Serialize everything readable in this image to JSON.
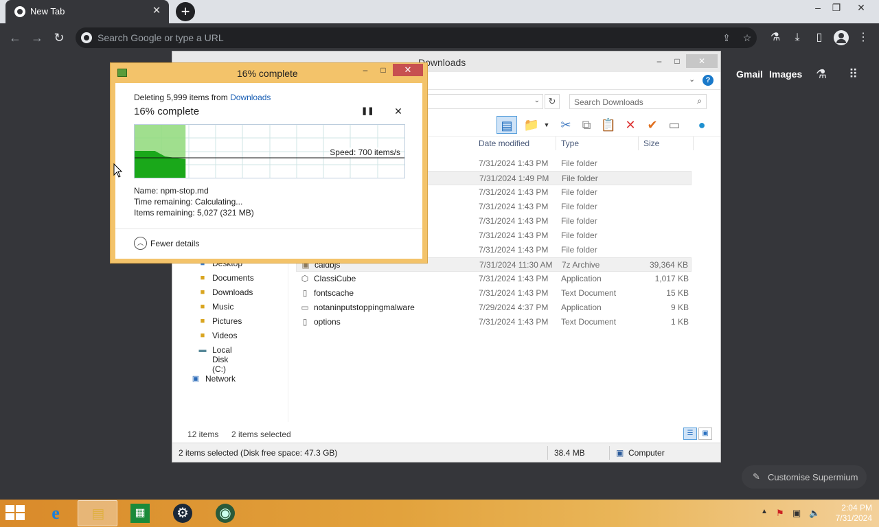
{
  "browser": {
    "tab_title": "New Tab",
    "tab_close": "✕",
    "new_tab": "+",
    "omnibox_placeholder": "Search Google or type a URL"
  },
  "ntp": {
    "gmail": "Gmail",
    "images": "Images",
    "customise": "Customise Supermium"
  },
  "explorer": {
    "title": "Downloads",
    "search_placeholder": "Search Downloads",
    "columns": {
      "date": "Date modified",
      "type": "Type",
      "size": "Size"
    },
    "rows": [
      {
        "name": "",
        "date": "7/31/2024 1:43 PM",
        "type": "File folder",
        "size": "",
        "icon": "folder-icon"
      },
      {
        "name": "",
        "date": "7/31/2024 1:49 PM",
        "type": "File folder",
        "size": "",
        "icon": "folder-icon"
      },
      {
        "name": "",
        "date": "7/31/2024 1:43 PM",
        "type": "File folder",
        "size": "",
        "icon": "folder-icon"
      },
      {
        "name": "",
        "date": "7/31/2024 1:43 PM",
        "type": "File folder",
        "size": "",
        "icon": "folder-icon"
      },
      {
        "name": "",
        "date": "7/31/2024 1:43 PM",
        "type": "File folder",
        "size": "",
        "icon": "folder-icon"
      },
      {
        "name": "",
        "date": "7/31/2024 1:43 PM",
        "type": "File folder",
        "size": "",
        "icon": "folder-icon"
      },
      {
        "name": "",
        "date": "7/31/2024 1:43 PM",
        "type": "File folder",
        "size": "",
        "icon": "folder-icon"
      },
      {
        "name": "caldbjs",
        "date": "7/31/2024 11:30 AM",
        "type": "7z Archive",
        "size": "39,364 KB",
        "icon": "archive-icon"
      },
      {
        "name": "ClassiCube",
        "date": "7/31/2024 1:43 PM",
        "type": "Application",
        "size": "1,017 KB",
        "icon": "application-icon"
      },
      {
        "name": "fontscache",
        "date": "7/31/2024 1:43 PM",
        "type": "Text Document",
        "size": "15 KB",
        "icon": "text-document-icon"
      },
      {
        "name": "notaninputstoppingmalware",
        "date": "7/29/2024 4:37 PM",
        "type": "Application",
        "size": "9 KB",
        "icon": "application-icon"
      },
      {
        "name": "options",
        "date": "7/31/2024 1:43 PM",
        "type": "Text Document",
        "size": "1 KB",
        "icon": "text-document-icon"
      }
    ],
    "nav": {
      "desktop": "Desktop",
      "documents": "Documents",
      "downloads": "Downloads",
      "music": "Music",
      "pictures": "Pictures",
      "videos": "Videos",
      "local_disk": "Local Disk (C:)",
      "network": "Network"
    },
    "status_items": "12 items",
    "status_selected": "2 items selected",
    "statusbar_left": "2 items selected (Disk free space: 47.3 GB)",
    "statusbar_size": "38.4 MB",
    "statusbar_computer": "Computer"
  },
  "dialog": {
    "title": "16% complete",
    "deleting_prefix": "Deleting 5,999 items from ",
    "deleting_link": "Downloads",
    "progress_text": "16% complete",
    "progress_fraction": 0.16,
    "speed": "Speed: 700 items/s",
    "name_line": "Name:  npm-stop.md",
    "time_line": "Time remaining:  Calculating...",
    "items_line": "Items remaining:  5,027 (321 MB)",
    "fewer_details": "Fewer details"
  },
  "taskbar": {
    "time": "2:04 PM",
    "date": "7/31/2024"
  }
}
